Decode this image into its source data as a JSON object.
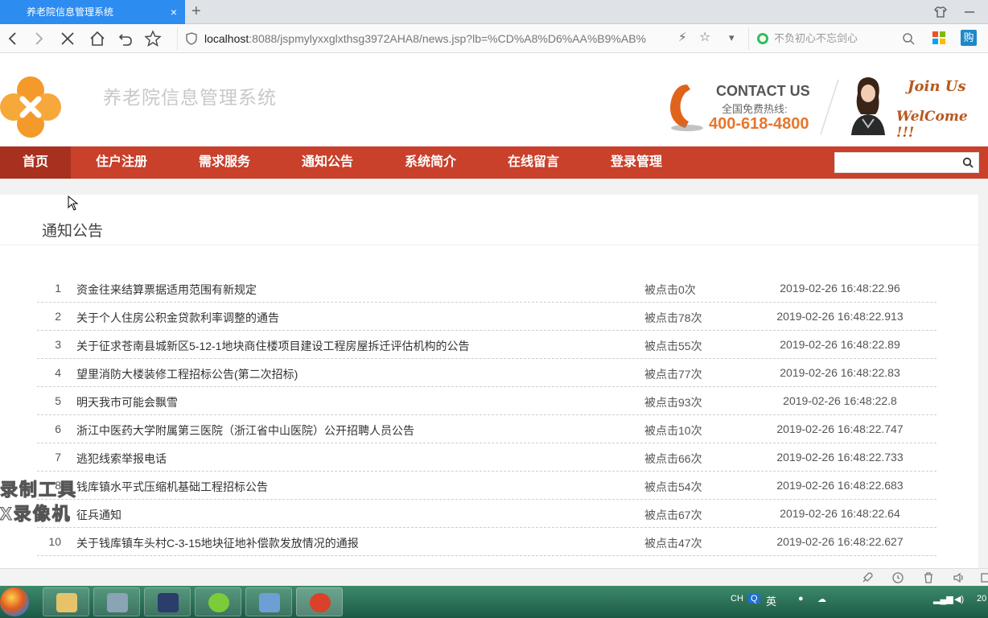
{
  "browser": {
    "tab_title": "养老院信息管理系统",
    "tab_close": "×",
    "new_tab": "+",
    "url_host": "localhost",
    "url_rest": ":8088/jspmylyxxglxthsg3972AHA8/news.jsp?lb=%CD%A8%D6%AA%B9%AB%",
    "search_placeholder": "不负初心不忘剑心",
    "ext_label": "购"
  },
  "header": {
    "site_title": "养老院信息管理系统",
    "contact_title": "CONTACT US",
    "hotline_label": "全国免费热线:",
    "hotline_number": "400-618-4800",
    "join_text": "Join Us",
    "welcome_text": "WelCome !!!"
  },
  "menu": {
    "items": [
      {
        "label": "首页"
      },
      {
        "label": "住户注册"
      },
      {
        "label": "需求服务"
      },
      {
        "label": "通知公告"
      },
      {
        "label": "系统简介"
      },
      {
        "label": "在线留言"
      },
      {
        "label": "登录管理"
      }
    ],
    "search_placeholder": ""
  },
  "content": {
    "section_title": "通知公告",
    "news": [
      {
        "num": "1",
        "title": "资金往来结算票据适用范围有新规定",
        "clicks": "被点击0次",
        "date": "2019-02-26 16:48:22.96"
      },
      {
        "num": "2",
        "title": "关于个人住房公积金贷款利率调整的通告",
        "clicks": "被点击78次",
        "date": "2019-02-26 16:48:22.913"
      },
      {
        "num": "3",
        "title": "关于征求苍南县城新区5-12-1地块商住楼项目建设工程房屋拆迁评估机构的公告",
        "clicks": "被点击55次",
        "date": "2019-02-26 16:48:22.89"
      },
      {
        "num": "4",
        "title": "望里消防大楼装修工程招标公告(第二次招标)",
        "clicks": "被点击77次",
        "date": "2019-02-26 16:48:22.83"
      },
      {
        "num": "5",
        "title": "明天我市可能会飘雪",
        "clicks": "被点击93次",
        "date": "2019-02-26 16:48:22.8"
      },
      {
        "num": "6",
        "title": "浙江中医药大学附属第三医院（浙江省中山医院）公开招聘人员公告",
        "clicks": "被点击10次",
        "date": "2019-02-26 16:48:22.747"
      },
      {
        "num": "7",
        "title": "逃犯线索举报电话",
        "clicks": "被点击66次",
        "date": "2019-02-26 16:48:22.733"
      },
      {
        "num": "8",
        "title": "钱库镇水平式压缩机基础工程招标公告",
        "clicks": "被点击54次",
        "date": "2019-02-26 16:48:22.683"
      },
      {
        "num": "9",
        "title": "征兵通知",
        "clicks": "被点击67次",
        "date": "2019-02-26 16:48:22.64"
      },
      {
        "num": "10",
        "title": "关于钱库镇车头村C-3-15地块征地补偿款发放情况的通报",
        "clicks": "被点击47次",
        "date": "2019-02-26 16:48:22.627"
      }
    ]
  },
  "taskbar": {
    "ime_ch": "CH",
    "ime_lang": "英",
    "clock_partial": "20"
  },
  "watermark": {
    "line1": "录制工具",
    "line2": "X录像机"
  },
  "colors": {
    "menu_red": "#c9402b",
    "tab_blue": "#2d8cf0",
    "phone_orange": "#e8762c"
  }
}
